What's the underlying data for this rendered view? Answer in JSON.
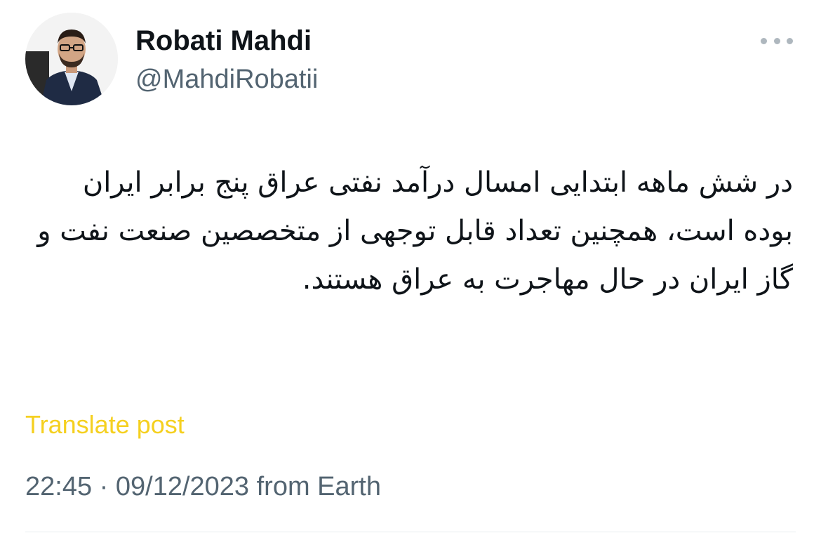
{
  "author": {
    "display_name": "Robati Mahdi",
    "handle": "@MahdiRobatii",
    "avatar_icon": "profile-photo"
  },
  "more_icon": "more-options-icon",
  "post": {
    "text": "در شش ماهه ابتدایی امسال درآمد نفتی عراق پنج برابر ایران بوده است، همچنین تعداد قابل توجهی از متخصصین صنعت نفت و گاز ایران در حال مهاجرت به عراق هستند.",
    "direction": "rtl"
  },
  "translate_label": "Translate post",
  "meta": {
    "timestamp": "22:45 · 09/12/2023 from Earth"
  },
  "colors": {
    "text_primary": "#0f1419",
    "text_secondary": "#536471",
    "translate_link": "#f5d020",
    "divider": "#e6ecf0"
  }
}
